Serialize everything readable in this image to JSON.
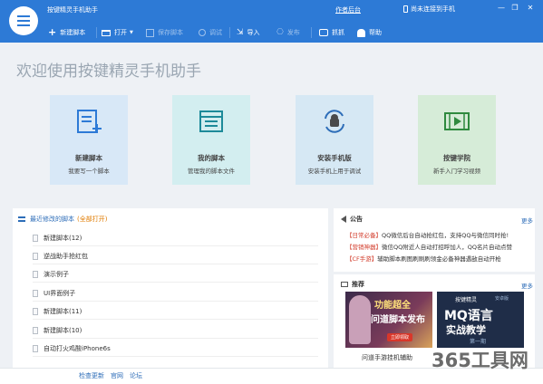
{
  "window": {
    "title": "按键精灵手机助手",
    "author_link": "作者后台",
    "device_status": "尚未连接到手机",
    "controls": [
      "minimize-icon",
      "restore-icon",
      "close-icon"
    ]
  },
  "toolbar": {
    "new_script": "新建脚本",
    "open": "打开",
    "save_script": "保存脚本",
    "debug": "调试",
    "import": "导入",
    "publish": "发布",
    "capture": "抓抓",
    "help": "帮助"
  },
  "welcome": "欢迎使用按键精灵手机助手",
  "cards": [
    {
      "title": "新建脚本",
      "desc": "我要写一个脚本",
      "icon": "new-script-icon",
      "color": "#d8e8f7"
    },
    {
      "title": "我的脚本",
      "desc": "管理我的脚本文件",
      "icon": "my-scripts-icon",
      "color": "#d3eef0"
    },
    {
      "title": "安装手机版",
      "desc": "安装手机上用于调试",
      "icon": "install-android-icon",
      "color": "#d6e8f4"
    },
    {
      "title": "按键学院",
      "desc": "新手入门学习视频",
      "icon": "video-icon",
      "color": "#d6ecd8"
    }
  ],
  "recent": {
    "title": "最近修改的脚本",
    "open_all": "(全部打开)",
    "items": [
      "新建脚本(12)",
      "逆战助手抢红包",
      "演示例子",
      "UI界面例子",
      "新建脚本(11)",
      "新建脚本(10)",
      "自动打火鸡酸iPhone6s"
    ]
  },
  "announcements": {
    "title": "公告",
    "more": "更多",
    "items": [
      {
        "tag": "【日常必备】",
        "text": "QQ微信后台自动抢红包，支持QQ与微信同时抢!"
      },
      {
        "tag": "【营销神器】",
        "text": "微信QQ附近人自动打招呼加人，QQ名片自动点赞"
      },
      {
        "tag": "【CF手游】",
        "text": "辅助脚本刷图刷刷刷领金必备神器遇敌自动开枪"
      }
    ]
  },
  "recommend": {
    "title": "推荐",
    "more": "更多",
    "caption": "问道手游挂机辅助",
    "banner1": {
      "line1": "功能超全",
      "line2": "问道脚本发布",
      "btn": "立即领取"
    },
    "banner2": {
      "brand": "按键精灵",
      "sub": "安卓版",
      "line1": "MQ语言",
      "line2": "实战教学",
      "foot": "第一期"
    }
  },
  "footer": {
    "links": [
      "检查更新",
      "官网",
      "论坛"
    ]
  },
  "watermark": "365工具网"
}
